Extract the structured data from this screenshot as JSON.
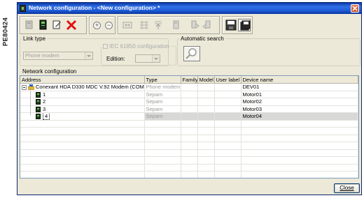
{
  "side_label": "PE80424",
  "window": {
    "title": "Network configuration - <New configuration> *"
  },
  "toolbar": {
    "icons": [
      "new-config-icon",
      "open-icon",
      "edit-icon",
      "delete-icon",
      "add-icon",
      "remove-icon",
      "network-icon",
      "network-grid-icon",
      "import-icon",
      "device-icon",
      "upload-icon",
      "download-icon",
      "save-icon",
      "save-as-icon"
    ]
  },
  "link_type": {
    "legend": "Link type",
    "selected": "Phone modem"
  },
  "iec": {
    "legend": "IEC 61850 configuration",
    "edition_label": "Edition:",
    "edition_value": ""
  },
  "auto_search": {
    "legend": "Automatic search"
  },
  "network": {
    "legend": "Network configuration",
    "columns": [
      "Address",
      "Type",
      "Family",
      "Model",
      "User label",
      "Device name"
    ],
    "rows": [
      {
        "address": "Conexant HDA D330 MDC V.92 Modem (COM3)",
        "type": "Phone modem",
        "family": "",
        "model": "",
        "user_label": "",
        "device": "DEV01"
      },
      {
        "address": "1",
        "type": "Sepam",
        "family": "",
        "model": "",
        "user_label": "",
        "device": "Motor01"
      },
      {
        "address": "2",
        "type": "Sepam",
        "family": "",
        "model": "",
        "user_label": "",
        "device": "Motor02"
      },
      {
        "address": "3",
        "type": "Sepam",
        "family": "",
        "model": "",
        "user_label": "",
        "device": "Motor03"
      },
      {
        "address": "4",
        "type": "Sepam",
        "family": "",
        "model": "",
        "user_label": "",
        "device": "Motor04"
      }
    ]
  },
  "buttons": {
    "close_label": "Close"
  },
  "colors": {
    "titlebar": "#1f5bd6",
    "delete_icon": "#e01010",
    "window_bg": "#ece9d8"
  }
}
